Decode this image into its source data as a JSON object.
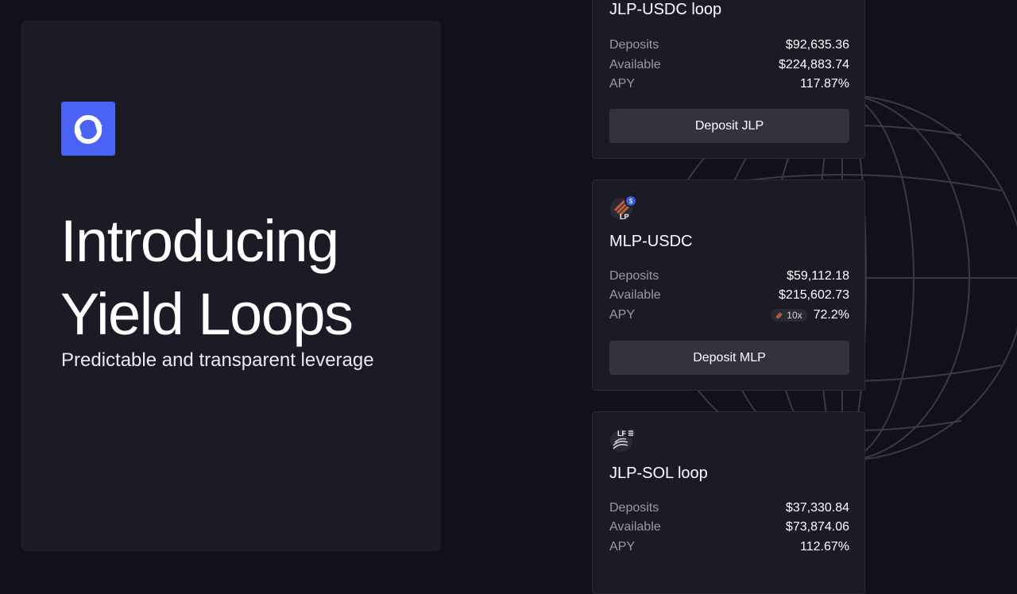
{
  "hero": {
    "title_line1": "Introducing",
    "title_line2": "Yield Loops",
    "subtitle": "Predictable and transparent leverage",
    "logo_icon": "loop-arrows-icon"
  },
  "colors": {
    "background": "#111119",
    "panel": "#1b1b25",
    "brand": "#4a63f5",
    "button": "#33333f",
    "label": "#9a9aa6"
  },
  "cards": [
    {
      "title": "JLP-USDC loop",
      "icon": "jlp-usdc-token-icon",
      "rows": [
        {
          "label": "Deposits",
          "value": "$92,635.36"
        },
        {
          "label": "Available",
          "value": "$224,883.74"
        },
        {
          "label": "APY",
          "value": "117.87%"
        }
      ],
      "button": "Deposit JLP"
    },
    {
      "title": "MLP-USDC",
      "icon": "mlp-usdc-token-icon",
      "icon_text": "LP",
      "rows": [
        {
          "label": "Deposits",
          "value": "$59,112.18"
        },
        {
          "label": "Available",
          "value": "$215,602.73"
        },
        {
          "label": "APY",
          "value": "72.2%",
          "badge": "10x",
          "badge_icon": "multiplier-flame-icon"
        }
      ],
      "button": "Deposit MLP"
    },
    {
      "title": "JLP-SOL loop",
      "icon": "jlp-sol-token-icon",
      "icon_text": "LF",
      "rows": [
        {
          "label": "Deposits",
          "value": "$37,330.84"
        },
        {
          "label": "Available",
          "value": "$73,874.06"
        },
        {
          "label": "APY",
          "value": "112.67%"
        }
      ]
    }
  ]
}
